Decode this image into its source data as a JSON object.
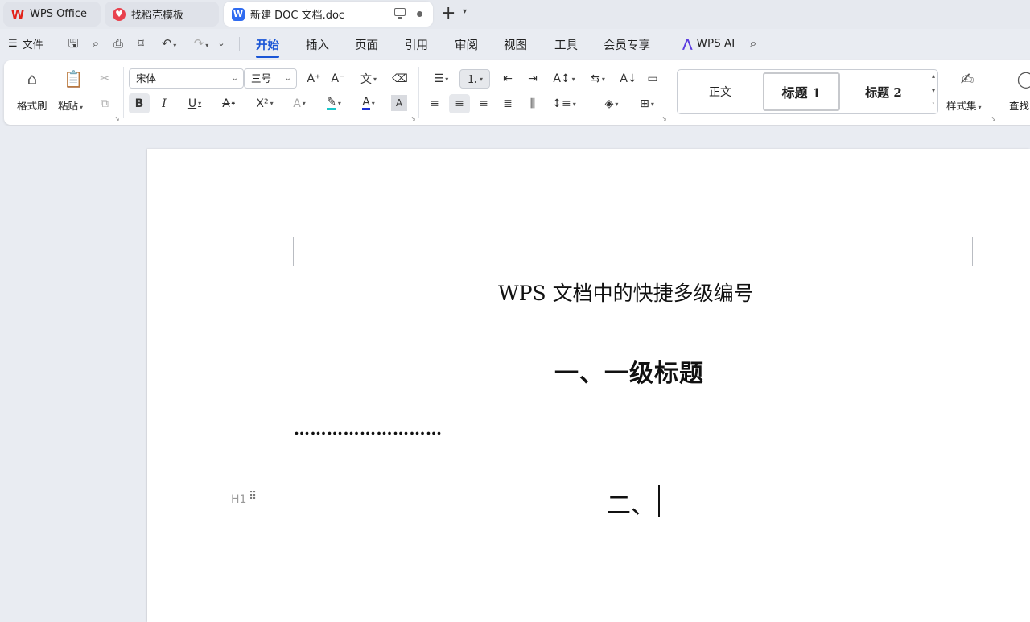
{
  "tabs": [
    {
      "label": "WPS Office",
      "icon": "wps-logo-icon"
    },
    {
      "label": "找稻壳模板",
      "icon": "docer-logo-icon"
    },
    {
      "label": "新建 DOC 文档.doc",
      "icon": "writer-doc-icon",
      "icon_letter": "W"
    }
  ],
  "menu": {
    "file": "文件",
    "tabs": [
      "开始",
      "插入",
      "页面",
      "引用",
      "审阅",
      "视图",
      "工具",
      "会员专享"
    ],
    "active_tab": "开始",
    "ai": "WPS AI"
  },
  "ribbon": {
    "format_painter": "格式刷",
    "paste": "粘贴",
    "font_name": "宋体",
    "font_size": "三号",
    "styles": {
      "normal": "正文",
      "heading1": "标题 1",
      "heading2": "标题 2"
    },
    "style_set": "样式集",
    "find": "查找"
  },
  "document": {
    "title": "WPS 文档中的快捷多级编号",
    "heading1": "一、一级标题",
    "dots": "………………………",
    "heading2_partial": "二、",
    "heading_marker": "H1"
  },
  "colors": {
    "accent": "#1a55d6",
    "highlight_bar": "#19c6c9",
    "font_color_bar": "#1a30d6"
  }
}
